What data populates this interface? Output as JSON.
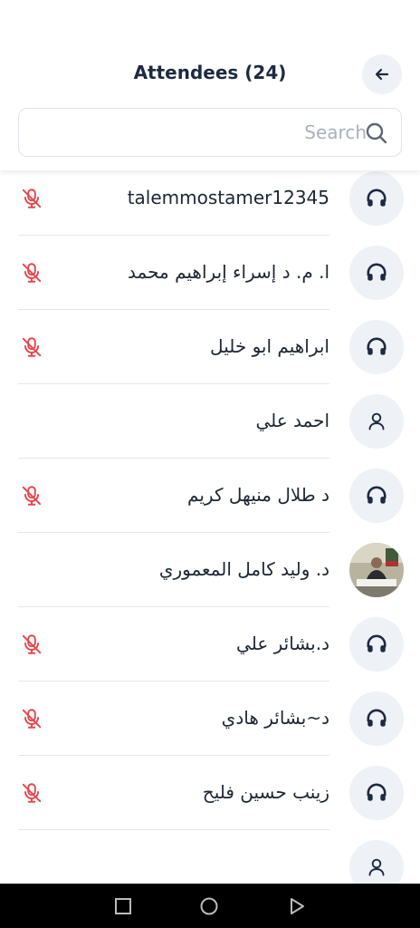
{
  "header": {
    "title": "Attendees (24)",
    "back_icon": "arrow-left-icon"
  },
  "search": {
    "placeholder": "Search",
    "value": "",
    "icon": "search-icon"
  },
  "attendees": [
    {
      "name": "talemmostamer12345",
      "avatar": "headphones-icon",
      "mic": "mic-muted-icon"
    },
    {
      "name": "ا. م. د إسراء إبراهيم محمد",
      "avatar": "headphones-icon",
      "mic": "mic-muted-icon"
    },
    {
      "name": "ابراهيم ابو خليل",
      "avatar": "headphones-icon",
      "mic": "mic-muted-icon"
    },
    {
      "name": "احمد علي",
      "avatar": "user-icon",
      "mic": ""
    },
    {
      "name": "د طلال منيهل كريم",
      "avatar": "headphones-icon",
      "mic": "mic-muted-icon"
    },
    {
      "name": "د. وليد كامل المعموري",
      "avatar": "photo",
      "mic": ""
    },
    {
      "name": "د.بشائر علي",
      "avatar": "headphones-icon",
      "mic": "mic-muted-icon"
    },
    {
      "name": "د~بشائر هادي",
      "avatar": "headphones-icon",
      "mic": "mic-muted-icon"
    },
    {
      "name": "زينب حسين فليح",
      "avatar": "headphones-icon",
      "mic": "mic-muted-icon"
    },
    {
      "name": "",
      "avatar": "user-icon",
      "mic": ""
    }
  ],
  "colors": {
    "muted_mic": "#e5484d",
    "avatar_bg": "#eef1f6",
    "title": "#1d2a40"
  },
  "navbar": {
    "buttons": [
      "recents-square-icon",
      "home-circle-icon",
      "back-triangle-icon"
    ]
  }
}
